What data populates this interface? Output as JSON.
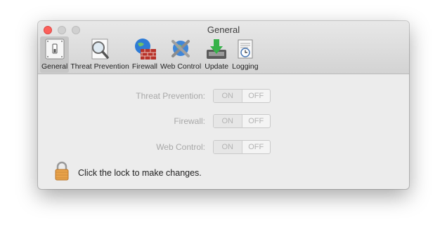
{
  "window": {
    "title": "General"
  },
  "tabs": [
    {
      "label": "General",
      "icon": "switch-icon",
      "selected": true
    },
    {
      "label": "Threat Prevention",
      "icon": "magnifier-icon",
      "selected": false
    },
    {
      "label": "Firewall",
      "icon": "globe-brick-icon",
      "selected": false
    },
    {
      "label": "Web Control",
      "icon": "globe-shield-icon",
      "selected": false
    },
    {
      "label": "Update",
      "icon": "download-tray-icon",
      "selected": false
    },
    {
      "label": "Logging",
      "icon": "log-clock-icon",
      "selected": false
    }
  ],
  "settings": [
    {
      "label": "Threat Prevention:",
      "on": "ON",
      "off": "OFF"
    },
    {
      "label": "Firewall:",
      "on": "ON",
      "off": "OFF"
    },
    {
      "label": "Web Control:",
      "on": "ON",
      "off": "OFF"
    }
  ],
  "lock": {
    "message": "Click the lock to make changes.",
    "icon": "padlock-icon"
  },
  "colors": {
    "close": "#fc605b",
    "disabled_text": "#a8a8a8"
  }
}
